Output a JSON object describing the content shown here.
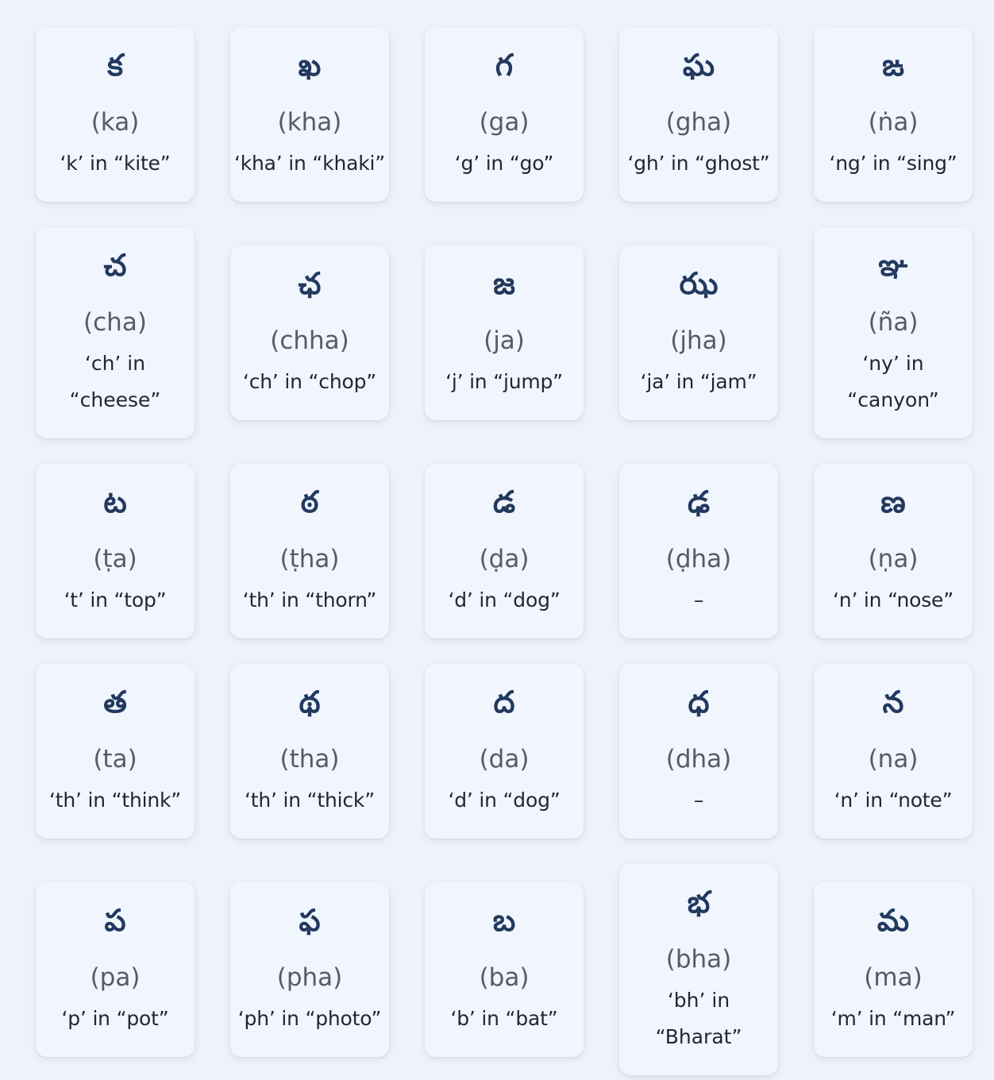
{
  "letters": [
    {
      "glyph": "క",
      "translit": "(ka)",
      "hint": "‘k’ in “kite”"
    },
    {
      "glyph": "ఖ",
      "translit": "(kha)",
      "hint": "‘kha’ in “khaki”"
    },
    {
      "glyph": "గ",
      "translit": "(ga)",
      "hint": "‘g’ in “go”"
    },
    {
      "glyph": "ఘ",
      "translit": "(gha)",
      "hint": "‘gh’ in “ghost”"
    },
    {
      "glyph": "ఙ",
      "translit": "(ṅa)",
      "hint": "‘ng’ in “sing”"
    },
    {
      "glyph": "చ",
      "translit": "(cha)",
      "hint": "‘ch’ in “cheese”"
    },
    {
      "glyph": "ఛ",
      "translit": "(chha)",
      "hint": "‘ch’ in “chop”"
    },
    {
      "glyph": "జ",
      "translit": "(ja)",
      "hint": "‘j’ in “jump”"
    },
    {
      "glyph": "ఝ",
      "translit": "(jha)",
      "hint": "‘ja’ in “jam”"
    },
    {
      "glyph": "ఞ",
      "translit": "(ña)",
      "hint": "‘ny’ in “canyon”"
    },
    {
      "glyph": "ట",
      "translit": "(ṭa)",
      "hint": "‘t’ in “top”"
    },
    {
      "glyph": "ఠ",
      "translit": "(ṭha)",
      "hint": "‘th’ in “thorn”"
    },
    {
      "glyph": "డ",
      "translit": "(ḍa)",
      "hint": "‘d’ in “dog”"
    },
    {
      "glyph": "ఢ",
      "translit": "(ḍha)",
      "hint": "–"
    },
    {
      "glyph": "ణ",
      "translit": "(ṇa)",
      "hint": "‘n’ in “nose”"
    },
    {
      "glyph": "త",
      "translit": "(ta)",
      "hint": "‘th’ in “think”"
    },
    {
      "glyph": "థ",
      "translit": "(tha)",
      "hint": "‘th’ in “thick”"
    },
    {
      "glyph": "ద",
      "translit": "(da)",
      "hint": "‘d’ in “dog”"
    },
    {
      "glyph": "ధ",
      "translit": "(dha)",
      "hint": "–"
    },
    {
      "glyph": "న",
      "translit": "(na)",
      "hint": "‘n’ in “note”"
    },
    {
      "glyph": "ప",
      "translit": "(pa)",
      "hint": "‘p’ in “pot”"
    },
    {
      "glyph": "ఫ",
      "translit": "(pha)",
      "hint": "‘ph’ in “photo”"
    },
    {
      "glyph": "బ",
      "translit": "(ba)",
      "hint": "‘b’ in “bat”"
    },
    {
      "glyph": "భ",
      "translit": "(bha)",
      "hint": "‘bh’ in “Bharat”"
    },
    {
      "glyph": "మ",
      "translit": "(ma)",
      "hint": "‘m’ in “man”"
    }
  ]
}
